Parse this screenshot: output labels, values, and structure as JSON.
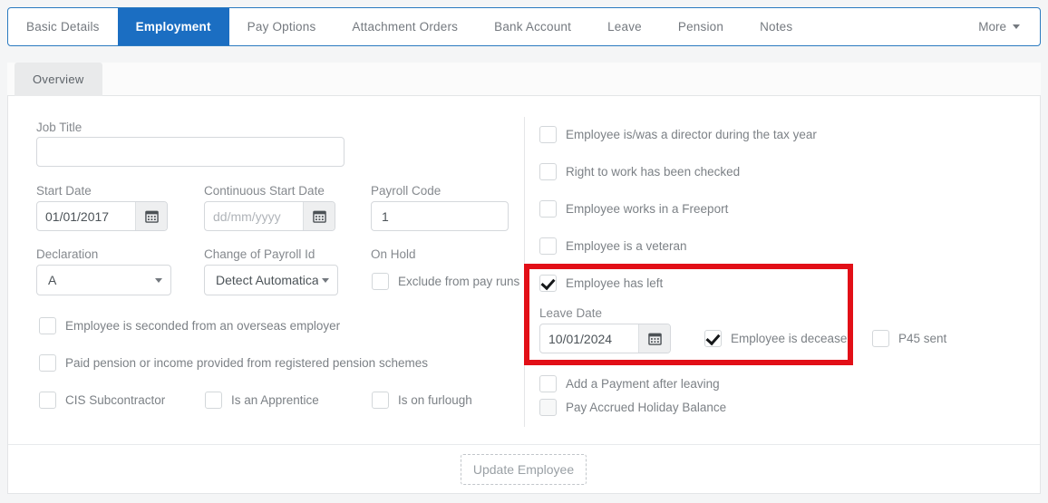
{
  "tabs": [
    {
      "label": "Basic Details",
      "active": false
    },
    {
      "label": "Employment",
      "active": true
    },
    {
      "label": "Pay Options",
      "active": false
    },
    {
      "label": "Attachment Orders",
      "active": false
    },
    {
      "label": "Bank Account",
      "active": false
    },
    {
      "label": "Leave",
      "active": false
    },
    {
      "label": "Pension",
      "active": false
    },
    {
      "label": "Notes",
      "active": false
    }
  ],
  "more_label": "More",
  "subtab": {
    "label": "Overview"
  },
  "left_column": {
    "job_title": {
      "label": "Job Title",
      "value": "",
      "placeholder": ""
    },
    "start_date": {
      "label": "Start Date",
      "value": "01/01/2017",
      "placeholder": "dd/mm/yyyy"
    },
    "continuous_start_date": {
      "label": "Continuous Start Date",
      "value": "",
      "placeholder": "dd/mm/yyyy"
    },
    "payroll_code": {
      "label": "Payroll Code",
      "value": "1",
      "placeholder": ""
    },
    "declaration": {
      "label": "Declaration",
      "value": "A"
    },
    "change_of_payroll_id": {
      "label": "Change of Payroll Id",
      "value": "Detect Automatical"
    },
    "on_hold": {
      "label": "On Hold"
    },
    "checkboxes": [
      {
        "label": "Exclude from pay runs",
        "checked": false
      },
      {
        "label": "Employee is seconded from an overseas employer",
        "checked": false
      },
      {
        "label": "Paid pension or income provided from registered pension schemes",
        "checked": false
      },
      {
        "label": "CIS Subcontractor",
        "checked": false
      },
      {
        "label": "Is an Apprentice",
        "checked": false
      },
      {
        "label": "Is on furlough",
        "checked": false
      }
    ]
  },
  "right_column": {
    "checkboxes": [
      {
        "label": "Employee is/was a director during the tax year",
        "checked": false
      },
      {
        "label": "Right to work has been checked",
        "checked": false
      },
      {
        "label": "Employee works in a Freeport",
        "checked": false
      },
      {
        "label": "Employee is a veteran",
        "checked": false
      }
    ],
    "leaver_section": {
      "has_left": {
        "label": "Employee has left",
        "checked": true
      },
      "leave_date": {
        "label": "Leave Date",
        "value": "10/01/2024",
        "placeholder": "dd/mm/yyyy"
      },
      "is_deceased": {
        "label": "Employee is deceased",
        "checked": true
      },
      "highlight_color": "#e20f17"
    },
    "p45_sent": {
      "label": "P45 sent",
      "checked": false
    },
    "after_leaving": [
      {
        "label": "Add a Payment after leaving",
        "checked": false
      },
      {
        "label": "Pay Accrued Holiday Balance",
        "checked": false
      }
    ]
  },
  "footer": {
    "update_button": "Update Employee"
  },
  "colors": {
    "accent": "#1b6ec2",
    "highlight": "#e20f17",
    "border": "#d5d8dc"
  }
}
